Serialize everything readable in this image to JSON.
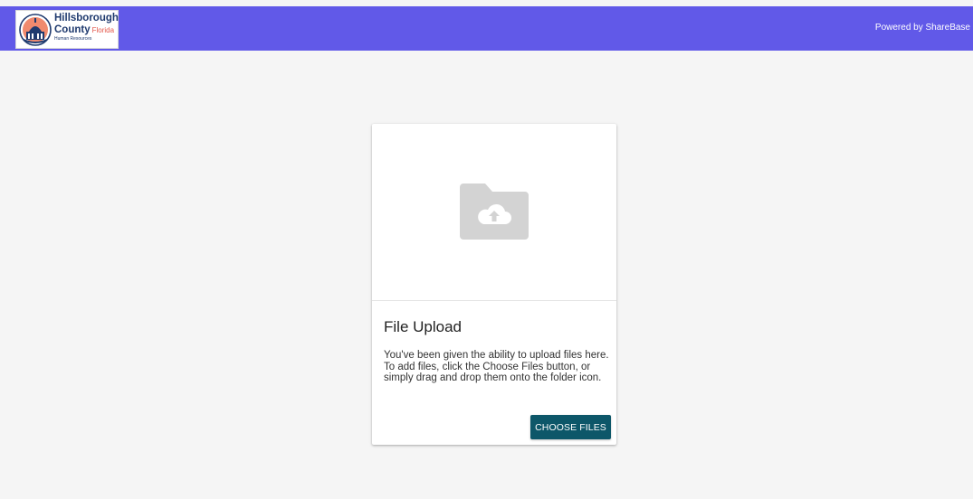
{
  "header": {
    "logo": {
      "line1": "Hillsborough",
      "line2": "County",
      "line2_accent": "Florida",
      "line3": "Human Resources"
    },
    "powered_by": "Powered by ShareBase",
    "background_color": "#6159e8"
  },
  "upload_card": {
    "dropzone_icon": "folder-upload-icon",
    "title": "File Upload",
    "description": "You've been given the ability to upload files here. To add files, click the Choose Files button, or simply drag and drop them onto the folder icon.",
    "choose_button_label": "CHOOSE FILES",
    "button_color": "#0d5769"
  }
}
